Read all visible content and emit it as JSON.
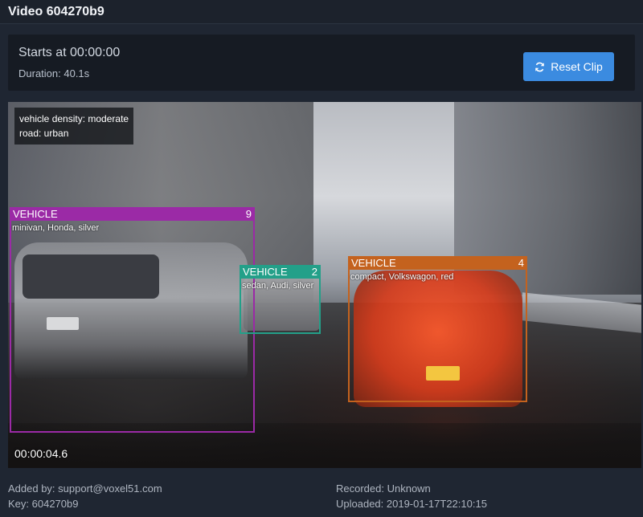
{
  "window": {
    "title": "Video 604270b9"
  },
  "clip": {
    "starts_label": "Starts at 00:00:00",
    "duration_label": "Duration: 40.1s",
    "reset_label": "Reset Clip",
    "reset_icon": "refresh-icon",
    "button_color": "#3b8be0"
  },
  "frame_attributes": [
    "vehicle density: moderate",
    "road: urban"
  ],
  "detections": [
    {
      "label": "VEHICLE",
      "id": "9",
      "attributes": "minivan, Honda, silver",
      "color": "#9b2aa6"
    },
    {
      "label": "VEHICLE",
      "id": "2",
      "attributes": "sedan, Audi, silver",
      "color": "#23a089"
    },
    {
      "label": "VEHICLE",
      "id": "4",
      "attributes": "compact, Volkswagon, red",
      "color": "#c4621e"
    }
  ],
  "playback": {
    "timestamp": "00:00:04.6"
  },
  "metadata": {
    "added_by": "Added by: support@voxel51.com",
    "key": "Key: 604270b9",
    "recorded": "Recorded: Unknown",
    "uploaded": "Uploaded: 2019-01-17T22:10:15"
  }
}
